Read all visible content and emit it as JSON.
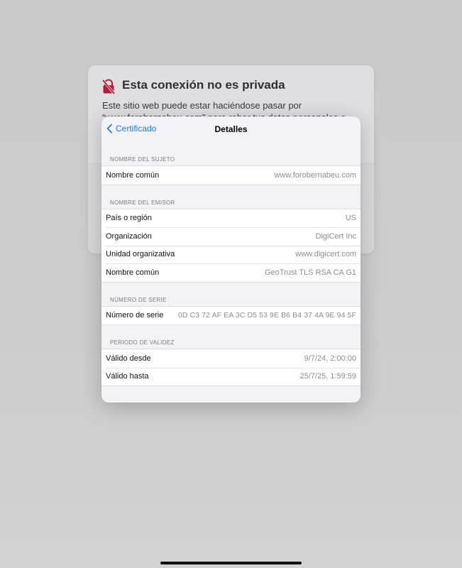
{
  "background_page": {
    "title": "Esta conexión no es privada",
    "body_lines": [
      "Este sitio web puede estar haciéndose pasar por",
      "“www.forobernabeu.com” para robar tus datos personales o"
    ],
    "icon": "lock-slash-icon",
    "accent_color": "#b0203a"
  },
  "modal": {
    "back_label": "Certificado",
    "title": "Detalles",
    "sections": [
      {
        "header": "NOMBRE DEL SUJETO",
        "rows": [
          {
            "label": "Nombre común",
            "value": "www.forobernabeu.com"
          }
        ]
      },
      {
        "header": "NOMBRE DEL EMISOR",
        "rows": [
          {
            "label": "País o región",
            "value": "US"
          },
          {
            "label": "Organización",
            "value": "DigiCert Inc"
          },
          {
            "label": "Unidad organizativa",
            "value": "www.digicert.com"
          },
          {
            "label": "Nombre común",
            "value": "GeoTrust TLS RSA CA G1"
          }
        ]
      },
      {
        "header": "NÚMERO DE SERIE",
        "rows": [
          {
            "label": "Número de serie",
            "value": "0D C3 72 AF EA 3C D5 53 9E B6 B4 37 4A 9E 94 5F"
          }
        ]
      },
      {
        "header": "PERIODO DE VALIDEZ",
        "rows": [
          {
            "label": "Válido desde",
            "value": "9/7/24, 2:00:00"
          },
          {
            "label": "Válido hasta",
            "value": "25/7/25, 1:59:59"
          }
        ]
      }
    ]
  },
  "colors": {
    "link_blue": "#1a7cf2"
  }
}
